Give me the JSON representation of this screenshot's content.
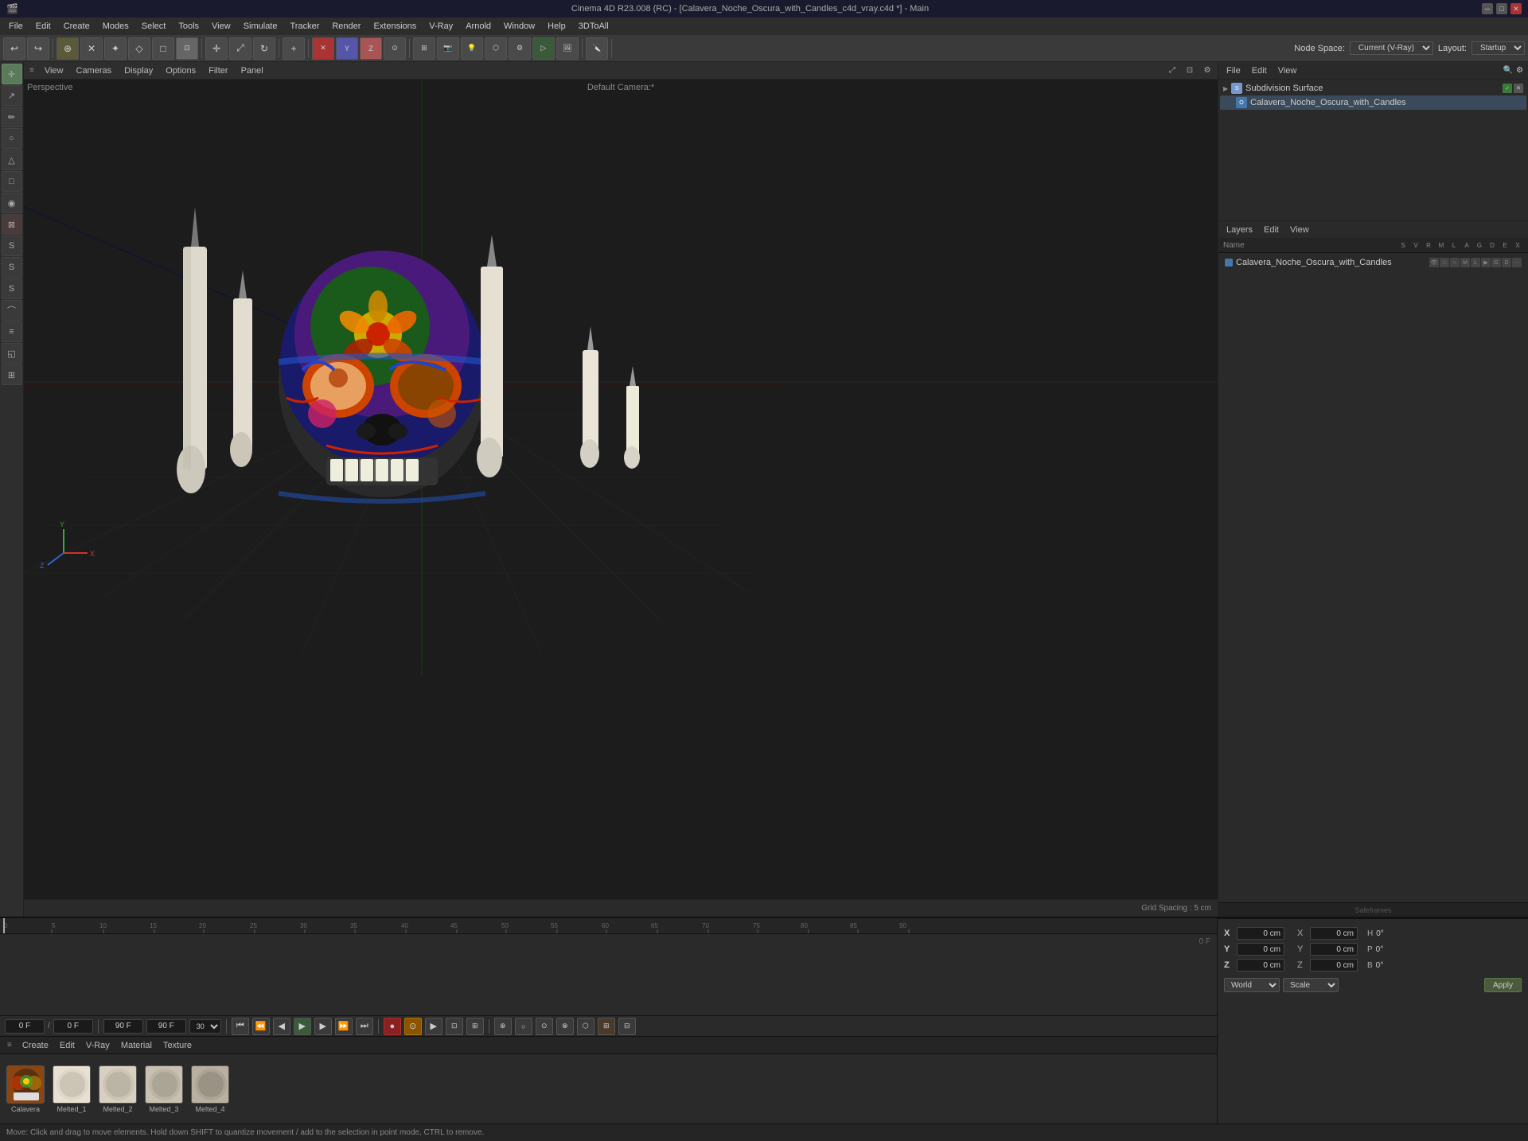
{
  "titlebar": {
    "title": "Cinema 4D R23.008 (RC) - [Calavera_Noche_Oscura_with_Candles_c4d_vray.c4d *] - Main",
    "minimize": "─",
    "maximize": "□",
    "close": "✕"
  },
  "menubar": {
    "items": [
      "File",
      "Edit",
      "Create",
      "Modes",
      "Select",
      "Tools",
      "View",
      "Simulate",
      "Tracker",
      "Render",
      "Extensions",
      "V-Ray",
      "Arnold",
      "Window",
      "Help",
      "3DToAll"
    ]
  },
  "toolbar": {
    "undo_label": "↩",
    "redo_label": "↪"
  },
  "node_space": {
    "label": "Node Space:",
    "value": "Current (V-Ray)",
    "layout_label": "Layout:",
    "layout_value": "Startup"
  },
  "viewport": {
    "perspective_label": "Perspective",
    "camera_label": "Default Camera:*",
    "grid_spacing": "Grid Spacing : 5 cm"
  },
  "viewport_toolbar": {
    "items": [
      "≡",
      "View",
      "Cameras",
      "Display",
      "Options",
      "Filter",
      "Panel"
    ]
  },
  "object_manager": {
    "toolbar_items": [
      "File",
      "Edit",
      "View"
    ],
    "objects": [
      {
        "name": "Subdivision Surface",
        "type": "subdiv",
        "color": "#7799cc"
      },
      {
        "name": "Calavera_Noche_Oscura_with_Candles",
        "type": "obj",
        "color": "#4477aa",
        "indent": 16
      }
    ]
  },
  "layers_panel": {
    "toolbar_items": [
      "Layers",
      "Edit",
      "View"
    ],
    "col_headers": [
      "Name",
      "S",
      "V",
      "R",
      "M",
      "L",
      "A",
      "G",
      "D",
      "E",
      "X"
    ],
    "items": [
      {
        "name": "Calavera_Noche_Oscura_with_Candles",
        "color": "#4477aa"
      }
    ]
  },
  "timeline": {
    "frame_markers": [
      0,
      5,
      10,
      15,
      20,
      25,
      30,
      35,
      40,
      45,
      50,
      55,
      60,
      65,
      70,
      75,
      80,
      85,
      90
    ],
    "start_frame": "0 F",
    "end_frame": "90 F",
    "current_frame": "0 F",
    "preview_start": "0 F",
    "preview_end": "90 F",
    "fps_display": "0 F"
  },
  "playback_controls": {
    "goto_start": "⏮",
    "prev_key": "⏪",
    "prev_frame": "◀",
    "play": "▶",
    "next_frame": "▶",
    "next_key": "⏩",
    "goto_end": "⏭",
    "stop": "■",
    "record": "●",
    "auto_key": "A",
    "motion_record": "M",
    "playback_mode": "▶"
  },
  "transport_right_buttons": [
    "●",
    "○",
    "⏺",
    "⊙",
    "⊕",
    "▶▶",
    "⊞",
    "⊟"
  ],
  "materials": {
    "toolbar_items": [
      "≡",
      "Create",
      "Edit",
      "V-Ray",
      "Material",
      "Texture"
    ],
    "items": [
      {
        "name": "Calavera",
        "thumb_color": "#8B4513"
      },
      {
        "name": "Melted_1",
        "thumb_color": "#e8e0d0"
      },
      {
        "name": "Melted_2",
        "thumb_color": "#d8d0c0"
      },
      {
        "name": "Melted_3",
        "thumb_color": "#c8c0b0"
      },
      {
        "name": "Melted_4",
        "thumb_color": "#b8b0a0"
      }
    ]
  },
  "coordinates": {
    "x_pos": "0 cm",
    "y_pos": "0 cm",
    "z_pos": "0 cm",
    "x_rot": "0°",
    "y_rot": "0°",
    "z_rot": "0°",
    "h_label": "H",
    "h_val": "0°",
    "p_label": "P",
    "p_val": "0°",
    "b_label": "B",
    "b_val": "0°"
  },
  "transform": {
    "space_label": "World",
    "transform_label": "Scale",
    "apply_label": "Apply"
  },
  "statusbar": {
    "text": "Move: Click and drag to move elements. Hold down SHIFT to quantize movement / add to the selection in point mode, CTRL to remove."
  },
  "left_tools": {
    "tools": [
      "⊕",
      "↗",
      "◇",
      "○",
      "△",
      "□",
      "◉",
      "⊠",
      "S",
      "S",
      "S",
      "⌒",
      "≡",
      "◱",
      "⊞"
    ]
  }
}
